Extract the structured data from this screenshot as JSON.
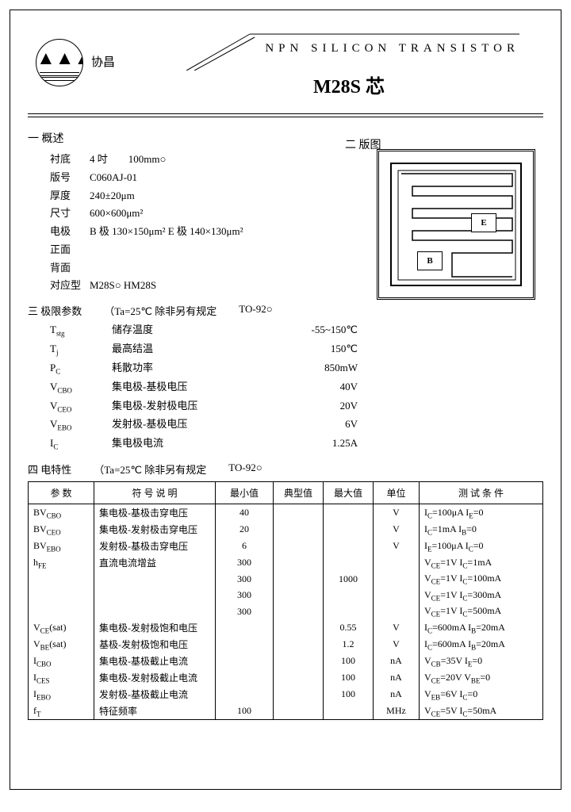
{
  "header": {
    "brand_text": "协昌",
    "product_type": "NPN  SILICON  TRANSISTOR",
    "part_number": "M28S 芯"
  },
  "section_titles": {
    "left": "一 概述",
    "right": "二 版图"
  },
  "specs": [
    {
      "label": "衬底",
      "value": "4 吋　　100mm○"
    },
    {
      "label": "版号",
      "value": "C060AJ-01"
    },
    {
      "label": "厚度",
      "value": "240±20μm"
    },
    {
      "label": "尺寸",
      "value": "600×600μm²"
    },
    {
      "label": "电极",
      "value": "B 极 130×150μm²  E 极 140×130μm²"
    },
    {
      "label": "正面",
      "value": ""
    },
    {
      "label": "背面",
      "value": ""
    },
    {
      "label": "对应型",
      "value": "M28S○ HM28S"
    }
  ],
  "chip": {
    "pad_e": "E",
    "pad_b": "B"
  },
  "ratings_header": {
    "title": "三 极限参数",
    "cond": "（Ta=25℃ 除非另有规定",
    "pkg": "TO-92○"
  },
  "ratings": [
    {
      "sym": "Tstg",
      "desc": "储存温度",
      "val": "-55~150℃"
    },
    {
      "sym": "Tj",
      "desc": "最高结温",
      "val": "150℃"
    },
    {
      "sym": "PC",
      "desc": "耗散功率",
      "val": "850mW"
    },
    {
      "sym": "VCBO",
      "desc": "集电极-基极电压",
      "val": "40V"
    },
    {
      "sym": "VCEO",
      "desc": "集电极-发射极电压",
      "val": "20V"
    },
    {
      "sym": "VEBO",
      "desc": "发射极-基极电压",
      "val": "6V"
    },
    {
      "sym": "IC",
      "desc": "集电极电流",
      "val": "1.25A"
    }
  ],
  "char_header": {
    "title": "四 电特性",
    "cond": "（Ta=25℃ 除非另有规定",
    "pkg": "TO-92○"
  },
  "table": {
    "headers": [
      "参 数",
      "符  号  说  明",
      "最小值",
      "典型值",
      "最大值",
      "单位",
      "测  试  条  件"
    ],
    "rows": [
      {
        "sym": "BVCBO",
        "par": "集电极-基极击穿电压",
        "min": "40",
        "typ": "",
        "max": "",
        "unit": "V",
        "cond": "IC=100μA  IE=0"
      },
      {
        "sym": "BVCEO",
        "par": "集电极-发射极击穿电压",
        "min": "20",
        "typ": "",
        "max": "",
        "unit": "V",
        "cond": "IC=1mA  IB=0"
      },
      {
        "sym": "BVEBO",
        "par": "发射极-基极击穿电压",
        "min": "6",
        "typ": "",
        "max": "",
        "unit": "V",
        "cond": "IE=100μA  IC=0"
      },
      {
        "sym": "hFE",
        "par": "直流电流增益",
        "min": "300",
        "typ": "",
        "max": "",
        "unit": "",
        "cond": "VCE=1V  IC=1mA"
      },
      {
        "sym": "",
        "par": "",
        "min": "300",
        "typ": "",
        "max": "1000",
        "unit": "",
        "cond": "VCE=1V  IC=100mA"
      },
      {
        "sym": "",
        "par": "",
        "min": "300",
        "typ": "",
        "max": "",
        "unit": "",
        "cond": "VCE=1V  IC=300mA"
      },
      {
        "sym": "",
        "par": "",
        "min": "300",
        "typ": "",
        "max": "",
        "unit": "",
        "cond": "VCE=1V  IC=500mA"
      },
      {
        "sym": "VCE(sat)",
        "par": "集电极-发射极饱和电压",
        "min": "",
        "typ": "",
        "max": "0.55",
        "unit": "V",
        "cond": "IC=600mA  IB=20mA"
      },
      {
        "sym": "VBE(sat)",
        "par": "基极-发射极饱和电压",
        "min": "",
        "typ": "",
        "max": "1.2",
        "unit": "V",
        "cond": "IC=600mA  IB=20mA"
      },
      {
        "sym": "ICBO",
        "par": "集电极-基极截止电流",
        "min": "",
        "typ": "",
        "max": "100",
        "unit": "nA",
        "cond": "VCB=35V  IE=0"
      },
      {
        "sym": "ICES",
        "par": "集电极-发射极截止电流",
        "min": "",
        "typ": "",
        "max": "100",
        "unit": "nA",
        "cond": "VCE=20V  VBE=0"
      },
      {
        "sym": "IEBO",
        "par": "发射极-基极截止电流",
        "min": "",
        "typ": "",
        "max": "100",
        "unit": "nA",
        "cond": "VEB=6V  IC=0"
      },
      {
        "sym": "fT",
        "par": "特征频率",
        "min": "100",
        "typ": "",
        "max": "",
        "unit": "MHz",
        "cond": "VCE=5V  IC=50mA"
      }
    ]
  }
}
